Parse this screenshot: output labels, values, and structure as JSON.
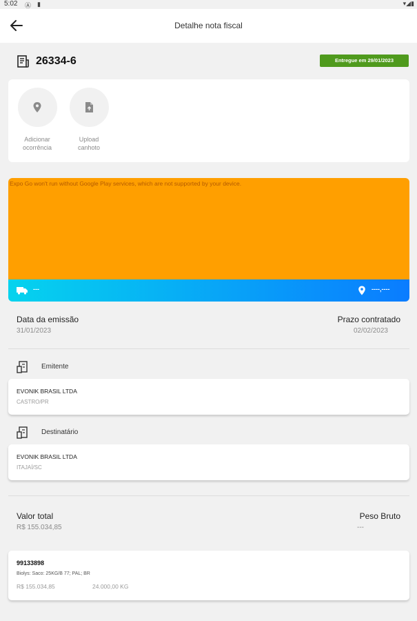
{
  "status_bar": {
    "time": "5:02"
  },
  "app_bar": {
    "title": "Detalhe nota fiscal"
  },
  "invoice": {
    "number": "26334-6",
    "status_badge": "Entregue em 29/01/2023",
    "status_color": "#4f9a1d"
  },
  "actions": [
    {
      "icon": "location-pin-icon",
      "line1": "Adicionar",
      "line2": "ocorrência"
    },
    {
      "icon": "upload-file-icon",
      "line1": "Upload",
      "line2": "canhoto"
    }
  ],
  "map": {
    "error_message": "Expo Go won't run without Google Play services, which are not supported by your device.",
    "background": "#ff9f00"
  },
  "route": {
    "origin": "---",
    "destination": "----,----"
  },
  "dates": {
    "emission_label": "Data da emissão",
    "emission_value": "31/01/2023",
    "deadline_label": "Prazo contratado",
    "deadline_value": "02/02/2023"
  },
  "emitter": {
    "section_label": "Emitente",
    "name": "EVONIK BRASIL LTDA",
    "city": "CASTRO/PR"
  },
  "recipient": {
    "section_label": "Destinatário",
    "name": "EVONIK BRASIL LTDA",
    "city": "ITAJAÍ/SC"
  },
  "totals": {
    "total_label": "Valor total",
    "total_value": "R$ 155.034,85",
    "weight_label": "Peso Bruto",
    "weight_value": "---"
  },
  "items": [
    {
      "code": "99133898",
      "description": "Biolys: Saco: 25KG/B 77; PAL; BR",
      "price": "R$ 155.034,85",
      "weight": "24.000,00 KG"
    }
  ]
}
